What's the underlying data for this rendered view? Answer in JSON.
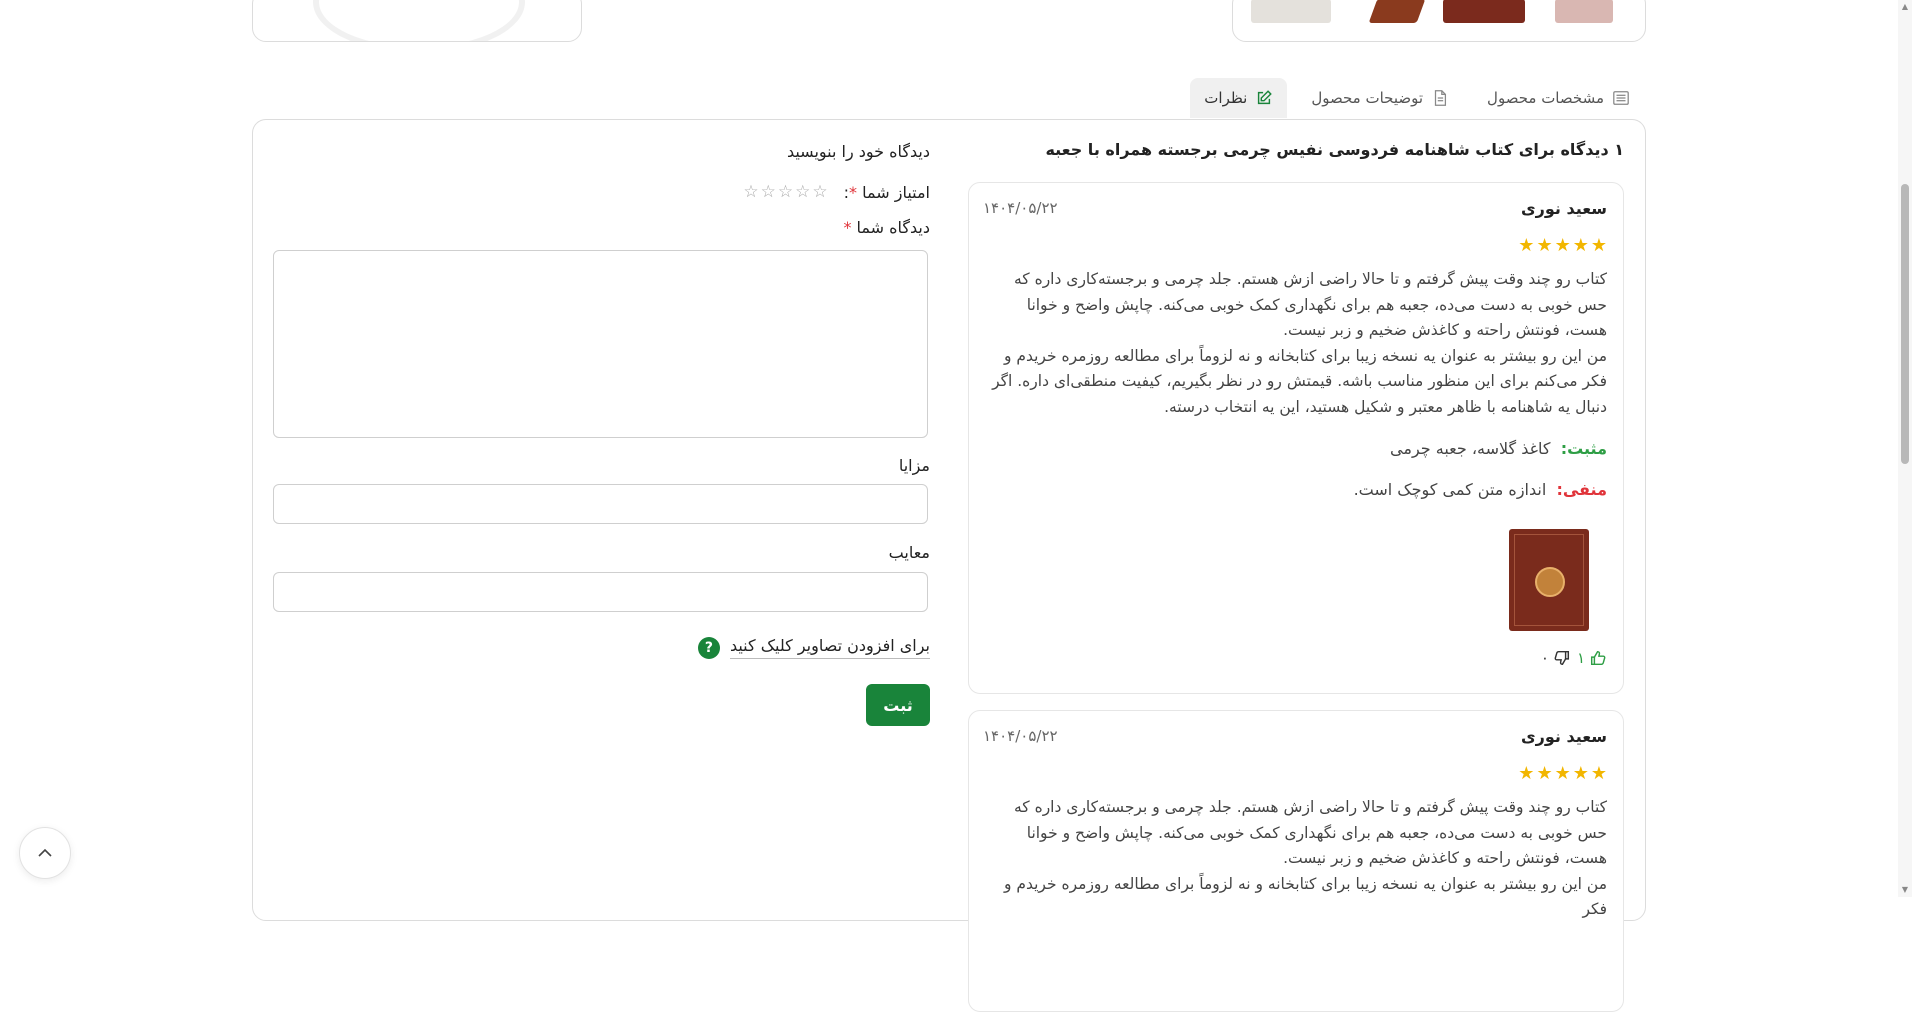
{
  "tabs": [
    {
      "label": "مشخصات محصول",
      "icon": "list-icon"
    },
    {
      "label": "توضیحات محصول",
      "icon": "document-icon"
    },
    {
      "label": "نظرات",
      "icon": "edit-icon",
      "active": true
    }
  ],
  "reviews_section": {
    "title": "۱ دیدگاه برای کتاب شاهنامه فردوسی نفیس چرمی برجسته همراه با جعبه",
    "reviews": [
      {
        "name": "سعید نوری",
        "date": "۱۴۰۴/۰۵/۲۲",
        "rating": 5,
        "paragraph1": "کتاب رو چند وقت پیش گرفتم و تا حالا راضی ازش هستم. جلد چرمی و برجسته‌کاری داره که حس خوبی به دست می‌ده، جعبه هم برای نگهداری کمک خوبی می‌کنه. چاپش واضح و خوانا هست، فونتش راحته و کاغذش ضخیم و زبر نیست.",
        "paragraph2": "من این رو بیشتر به عنوان یه نسخه زیبا برای کتابخانه و نه لزوماً برای مطالعه روزمره خریدم و فکر می‌کنم برای این منظور مناسب باشه. قیمتش رو در نظر بگیریم، کیفیت منطقی‌ای داره. اگر دنبال یه شاهنامه با ظاهر معتبر و شکیل هستید، این یه انتخاب درسته.",
        "positive_label": "مثبت:",
        "positive": "کاغذ گلاسه، جعبه چرمی",
        "negative_label": "منفی:",
        "negative": "اندازه متن کمی کوچک است.",
        "likes": "۱",
        "dislikes": "۰"
      },
      {
        "name": "سعید نوری",
        "date": "۱۴۰۴/۰۵/۲۲",
        "rating": 5,
        "paragraph1": "کتاب رو چند وقت پیش گرفتم و تا حالا راضی ازش هستم. جلد چرمی و برجسته‌کاری داره که حس خوبی به دست می‌ده، جعبه هم برای نگهداری کمک خوبی می‌کنه. چاپش واضح و خوانا هست، فونتش راحته و کاغذش ضخیم و زبر نیست.",
        "paragraph2": "من این رو بیشتر به عنوان یه نسخه زیبا برای کتابخانه و نه لزوماً برای مطالعه روزمره خریدم و فکر"
      }
    ]
  },
  "form": {
    "heading": "دیدگاه خود را بنویسید",
    "rating_label": "امتیاز شما",
    "required_mark": "*",
    "rating_colon": ":",
    "comment_label": "دیدگاه شما",
    "pros_label": "مزایا",
    "cons_label": "معایب",
    "upload_label": "برای افزودن تصاویر کلیک کنید",
    "help_mark": "?",
    "submit_label": "ثبت"
  },
  "colors": {
    "accent": "#19843a",
    "positive": "#2e9e45",
    "negative": "#e0343a",
    "star": "#f2b600"
  }
}
